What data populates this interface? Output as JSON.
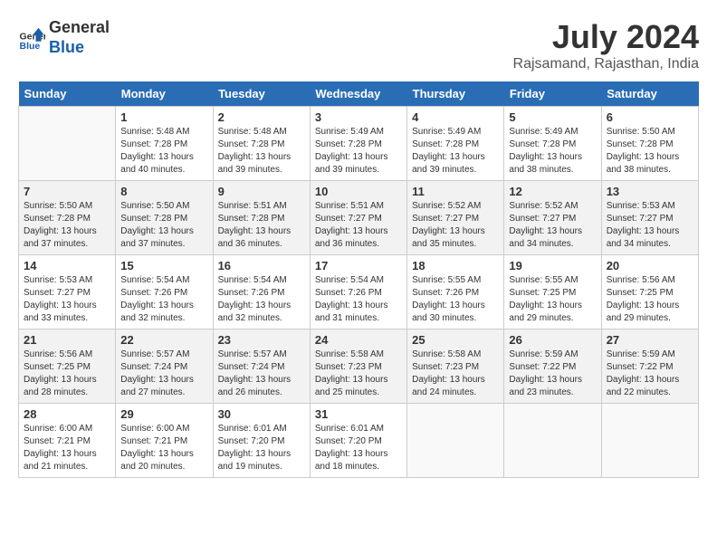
{
  "header": {
    "logo_line1": "General",
    "logo_line2": "Blue",
    "month_year": "July 2024",
    "location": "Rajsamand, Rajasthan, India"
  },
  "days_of_week": [
    "Sunday",
    "Monday",
    "Tuesday",
    "Wednesday",
    "Thursday",
    "Friday",
    "Saturday"
  ],
  "weeks": [
    [
      {
        "day": "",
        "info": ""
      },
      {
        "day": "1",
        "info": "Sunrise: 5:48 AM\nSunset: 7:28 PM\nDaylight: 13 hours\nand 40 minutes."
      },
      {
        "day": "2",
        "info": "Sunrise: 5:48 AM\nSunset: 7:28 PM\nDaylight: 13 hours\nand 39 minutes."
      },
      {
        "day": "3",
        "info": "Sunrise: 5:49 AM\nSunset: 7:28 PM\nDaylight: 13 hours\nand 39 minutes."
      },
      {
        "day": "4",
        "info": "Sunrise: 5:49 AM\nSunset: 7:28 PM\nDaylight: 13 hours\nand 39 minutes."
      },
      {
        "day": "5",
        "info": "Sunrise: 5:49 AM\nSunset: 7:28 PM\nDaylight: 13 hours\nand 38 minutes."
      },
      {
        "day": "6",
        "info": "Sunrise: 5:50 AM\nSunset: 7:28 PM\nDaylight: 13 hours\nand 38 minutes."
      }
    ],
    [
      {
        "day": "7",
        "info": "Sunrise: 5:50 AM\nSunset: 7:28 PM\nDaylight: 13 hours\nand 37 minutes."
      },
      {
        "day": "8",
        "info": "Sunrise: 5:50 AM\nSunset: 7:28 PM\nDaylight: 13 hours\nand 37 minutes."
      },
      {
        "day": "9",
        "info": "Sunrise: 5:51 AM\nSunset: 7:28 PM\nDaylight: 13 hours\nand 36 minutes."
      },
      {
        "day": "10",
        "info": "Sunrise: 5:51 AM\nSunset: 7:27 PM\nDaylight: 13 hours\nand 36 minutes."
      },
      {
        "day": "11",
        "info": "Sunrise: 5:52 AM\nSunset: 7:27 PM\nDaylight: 13 hours\nand 35 minutes."
      },
      {
        "day": "12",
        "info": "Sunrise: 5:52 AM\nSunset: 7:27 PM\nDaylight: 13 hours\nand 34 minutes."
      },
      {
        "day": "13",
        "info": "Sunrise: 5:53 AM\nSunset: 7:27 PM\nDaylight: 13 hours\nand 34 minutes."
      }
    ],
    [
      {
        "day": "14",
        "info": "Sunrise: 5:53 AM\nSunset: 7:27 PM\nDaylight: 13 hours\nand 33 minutes."
      },
      {
        "day": "15",
        "info": "Sunrise: 5:54 AM\nSunset: 7:26 PM\nDaylight: 13 hours\nand 32 minutes."
      },
      {
        "day": "16",
        "info": "Sunrise: 5:54 AM\nSunset: 7:26 PM\nDaylight: 13 hours\nand 32 minutes."
      },
      {
        "day": "17",
        "info": "Sunrise: 5:54 AM\nSunset: 7:26 PM\nDaylight: 13 hours\nand 31 minutes."
      },
      {
        "day": "18",
        "info": "Sunrise: 5:55 AM\nSunset: 7:26 PM\nDaylight: 13 hours\nand 30 minutes."
      },
      {
        "day": "19",
        "info": "Sunrise: 5:55 AM\nSunset: 7:25 PM\nDaylight: 13 hours\nand 29 minutes."
      },
      {
        "day": "20",
        "info": "Sunrise: 5:56 AM\nSunset: 7:25 PM\nDaylight: 13 hours\nand 29 minutes."
      }
    ],
    [
      {
        "day": "21",
        "info": "Sunrise: 5:56 AM\nSunset: 7:25 PM\nDaylight: 13 hours\nand 28 minutes."
      },
      {
        "day": "22",
        "info": "Sunrise: 5:57 AM\nSunset: 7:24 PM\nDaylight: 13 hours\nand 27 minutes."
      },
      {
        "day": "23",
        "info": "Sunrise: 5:57 AM\nSunset: 7:24 PM\nDaylight: 13 hours\nand 26 minutes."
      },
      {
        "day": "24",
        "info": "Sunrise: 5:58 AM\nSunset: 7:23 PM\nDaylight: 13 hours\nand 25 minutes."
      },
      {
        "day": "25",
        "info": "Sunrise: 5:58 AM\nSunset: 7:23 PM\nDaylight: 13 hours\nand 24 minutes."
      },
      {
        "day": "26",
        "info": "Sunrise: 5:59 AM\nSunset: 7:22 PM\nDaylight: 13 hours\nand 23 minutes."
      },
      {
        "day": "27",
        "info": "Sunrise: 5:59 AM\nSunset: 7:22 PM\nDaylight: 13 hours\nand 22 minutes."
      }
    ],
    [
      {
        "day": "28",
        "info": "Sunrise: 6:00 AM\nSunset: 7:21 PM\nDaylight: 13 hours\nand 21 minutes."
      },
      {
        "day": "29",
        "info": "Sunrise: 6:00 AM\nSunset: 7:21 PM\nDaylight: 13 hours\nand 20 minutes."
      },
      {
        "day": "30",
        "info": "Sunrise: 6:01 AM\nSunset: 7:20 PM\nDaylight: 13 hours\nand 19 minutes."
      },
      {
        "day": "31",
        "info": "Sunrise: 6:01 AM\nSunset: 7:20 PM\nDaylight: 13 hours\nand 18 minutes."
      },
      {
        "day": "",
        "info": ""
      },
      {
        "day": "",
        "info": ""
      },
      {
        "day": "",
        "info": ""
      }
    ]
  ]
}
